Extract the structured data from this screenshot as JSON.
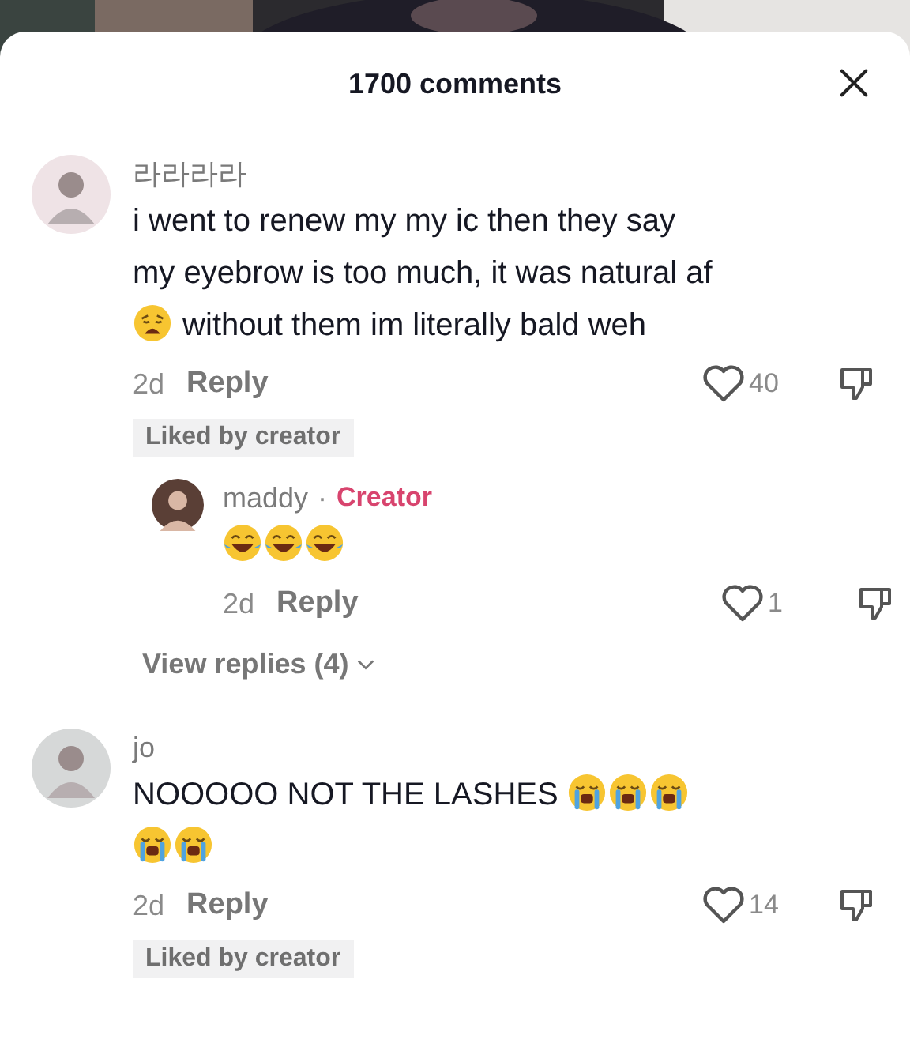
{
  "header": {
    "title": "1700 comments"
  },
  "comments": [
    {
      "username": "라라라라",
      "parts": [
        {
          "kind": "text",
          "text": "i went to renew my my ic then they say my eyebrow is too much, it was natural af"
        },
        {
          "kind": "weary"
        },
        {
          "kind": "text",
          "text": " without them im literally bald weh"
        }
      ],
      "age": "2d",
      "reply_label": "Reply",
      "likes": "40",
      "liked_by_creator": "Liked by creator",
      "replies": [
        {
          "username": "maddy",
          "separator": "·",
          "badge": "Creator",
          "parts": [
            {
              "kind": "joy"
            },
            {
              "kind": "joy"
            },
            {
              "kind": "joy"
            }
          ],
          "age": "2d",
          "reply_label": "Reply",
          "likes": "1"
        }
      ],
      "view_replies": "View replies (4)"
    },
    {
      "username": "jo",
      "parts": [
        {
          "kind": "text",
          "text": "NOOOOO NOT THE LASHES "
        },
        {
          "kind": "sob"
        },
        {
          "kind": "sob"
        },
        {
          "kind": "sob"
        },
        {
          "kind": "sob"
        },
        {
          "kind": "sob"
        }
      ],
      "age": "2d",
      "reply_label": "Reply",
      "likes": "14",
      "liked_by_creator": "Liked by creator"
    }
  ]
}
